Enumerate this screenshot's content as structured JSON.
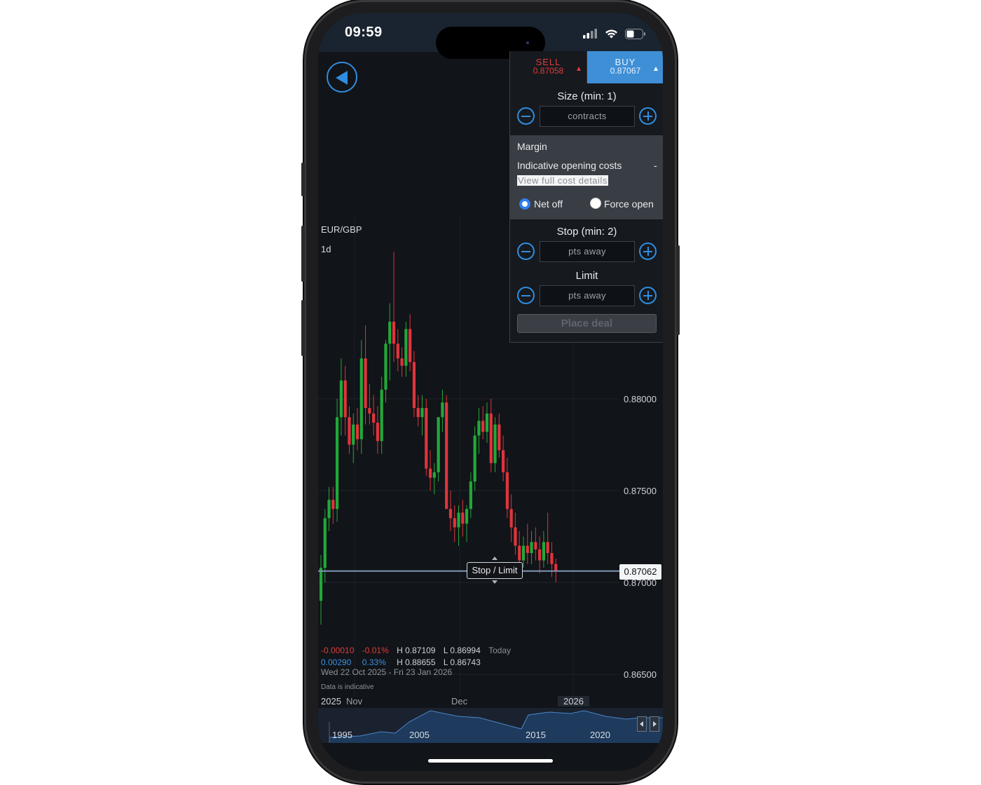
{
  "status": {
    "time": "09:59"
  },
  "instrument": {
    "symbol": "EUR/GBP",
    "timeframe": "1d"
  },
  "ticket": {
    "sell": {
      "label": "SELL",
      "price": "0.87058"
    },
    "buy": {
      "label": "BUY",
      "price": "0.87067"
    },
    "size": {
      "title": "Size (min: 1)",
      "placeholder": "contracts"
    },
    "margin": {
      "title": "Margin",
      "opening_costs_label": "Indicative opening costs",
      "opening_costs_value": "-",
      "view_link": "View full cost details"
    },
    "mode": {
      "net_off": "Net off",
      "force_open": "Force open",
      "selected": "Net off"
    },
    "stop": {
      "title": "Stop (min: 2)",
      "placeholder": "pts away"
    },
    "limit": {
      "title": "Limit",
      "placeholder": "pts away"
    },
    "place_deal": "Place deal"
  },
  "chart": {
    "price_labels": [
      "0.88000",
      "0.87500",
      "0.87000",
      "0.86500"
    ],
    "current_price": "0.87062",
    "stop_limit_label": "Stop / Limit",
    "stats": {
      "today": {
        "change": "-0.00010",
        "pct": "-0.01%",
        "high": "H 0.87109",
        "low": "L 0.86994",
        "label": "Today"
      },
      "range": {
        "change": "0.00290",
        "pct": "0.33%",
        "high": "H 0.88655",
        "low": "L 0.86743"
      },
      "date_range": "Wed 22 Oct 2025 - Fri 23 Jan 2026",
      "disclaimer": "Data is indicative"
    },
    "x_labels": [
      "2025",
      "Nov",
      "Dec",
      "2026"
    ],
    "navigator_labels": [
      "1995",
      "2005",
      "2015",
      "2020"
    ]
  },
  "chart_data": {
    "type": "candlestick",
    "title": "EUR/GBP",
    "interval": "1d",
    "ylim": [
      0.865,
      0.8895
    ],
    "y_ticks": [
      0.88,
      0.875,
      0.87,
      0.865
    ],
    "x_ticks": [
      "2025",
      "Nov",
      "Dec",
      "2026"
    ],
    "current_price": 0.87062,
    "colors": {
      "up": "#22a83a",
      "down": "#e0343d"
    },
    "candles": [
      [
        0.869,
        0.8715,
        0.8677,
        0.8708
      ],
      [
        0.8708,
        0.874,
        0.87,
        0.8735
      ],
      [
        0.8735,
        0.8752,
        0.8728,
        0.8745
      ],
      [
        0.8745,
        0.8752,
        0.8732,
        0.874
      ],
      [
        0.874,
        0.88,
        0.8733,
        0.879
      ],
      [
        0.879,
        0.8822,
        0.878,
        0.881
      ],
      [
        0.881,
        0.8818,
        0.878,
        0.879
      ],
      [
        0.879,
        0.8796,
        0.877,
        0.8775
      ],
      [
        0.8775,
        0.8792,
        0.8765,
        0.8786
      ],
      [
        0.8786,
        0.8795,
        0.8772,
        0.8778
      ],
      [
        0.8778,
        0.8832,
        0.877,
        0.8822
      ],
      [
        0.8822,
        0.884,
        0.8786,
        0.8795
      ],
      [
        0.8795,
        0.8808,
        0.8786,
        0.8792
      ],
      [
        0.8792,
        0.8802,
        0.878,
        0.8787
      ],
      [
        0.8787,
        0.8796,
        0.877,
        0.8777
      ],
      [
        0.8777,
        0.8812,
        0.877,
        0.8805
      ],
      [
        0.8805,
        0.8832,
        0.8798,
        0.883
      ],
      [
        0.883,
        0.8852,
        0.881,
        0.8842
      ],
      [
        0.8842,
        0.888,
        0.882,
        0.883
      ],
      [
        0.883,
        0.8838,
        0.8815,
        0.8822
      ],
      [
        0.8822,
        0.8828,
        0.8812,
        0.8818
      ],
      [
        0.8818,
        0.8842,
        0.8812,
        0.8838
      ],
      [
        0.8838,
        0.8846,
        0.8815,
        0.882
      ],
      [
        0.882,
        0.8826,
        0.879,
        0.8795
      ],
      [
        0.8795,
        0.8802,
        0.8785,
        0.879
      ],
      [
        0.879,
        0.8802,
        0.878,
        0.8795
      ],
      [
        0.8795,
        0.88,
        0.8758,
        0.8762
      ],
      [
        0.8762,
        0.8772,
        0.875,
        0.8757
      ],
      [
        0.8757,
        0.8765,
        0.8748,
        0.876
      ],
      [
        0.876,
        0.879,
        0.8755,
        0.879
      ],
      [
        0.879,
        0.8805,
        0.8782,
        0.8798
      ],
      [
        0.8798,
        0.8802,
        0.8755,
        0.874
      ],
      [
        0.874,
        0.875,
        0.8728,
        0.8735
      ],
      [
        0.8735,
        0.8742,
        0.8722,
        0.873
      ],
      [
        0.873,
        0.8742,
        0.872,
        0.8738
      ],
      [
        0.8738,
        0.8745,
        0.8725,
        0.8732
      ],
      [
        0.8732,
        0.8742,
        0.8722,
        0.874
      ],
      [
        0.874,
        0.876,
        0.8735,
        0.8755
      ],
      [
        0.8755,
        0.8785,
        0.875,
        0.878
      ],
      [
        0.878,
        0.8795,
        0.877,
        0.8788
      ],
      [
        0.8788,
        0.8796,
        0.8778,
        0.8782
      ],
      [
        0.8782,
        0.8798,
        0.8776,
        0.8792
      ],
      [
        0.8792,
        0.88,
        0.876,
        0.8765
      ],
      [
        0.8765,
        0.879,
        0.876,
        0.8786
      ],
      [
        0.8786,
        0.8792,
        0.8768,
        0.8772
      ],
      [
        0.8772,
        0.878,
        0.8755,
        0.876
      ],
      [
        0.876,
        0.8768,
        0.8735,
        0.874
      ],
      [
        0.874,
        0.8748,
        0.8722,
        0.873
      ],
      [
        0.873,
        0.8738,
        0.8715,
        0.872
      ],
      [
        0.872,
        0.8728,
        0.8705,
        0.8712
      ],
      [
        0.8712,
        0.8725,
        0.8708,
        0.872
      ],
      [
        0.872,
        0.8732,
        0.871,
        0.8716
      ],
      [
        0.8716,
        0.8728,
        0.871,
        0.8722
      ],
      [
        0.8722,
        0.873,
        0.8712,
        0.8718
      ],
      [
        0.8718,
        0.8725,
        0.8705,
        0.8712
      ],
      [
        0.8712,
        0.8728,
        0.8708,
        0.8722
      ],
      [
        0.8722,
        0.8738,
        0.871,
        0.8716
      ],
      [
        0.8716,
        0.8722,
        0.8703,
        0.871
      ],
      [
        0.871,
        0.8713,
        0.87,
        0.8706
      ]
    ]
  }
}
